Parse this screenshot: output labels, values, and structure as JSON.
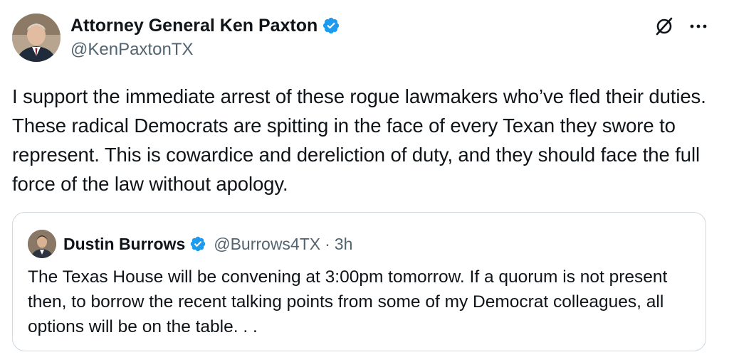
{
  "tweet": {
    "author": {
      "display_name": "Attorney General Ken Paxton",
      "handle": "@KenPaxtonTX",
      "avatar_icon": "avatar-ken-paxton",
      "verified_icon": "verified-badge-icon",
      "verified_color": "#1d9bf0"
    },
    "actions": {
      "grok_icon": "grok-icon",
      "more_icon": "more-icon"
    },
    "text": "I support the immediate arrest of these rogue lawmakers who’ve fled their duties. These radical Democrats are spitting in the face of every Texan they swore to represent. This is cowardice and dereliction of duty, and they should face the full force of the law without apology.",
    "quote": {
      "display_name": "Dustin Burrows",
      "handle": "@Burrows4TX",
      "separator": "·",
      "time": "3h",
      "avatar_icon": "avatar-dustin-burrows",
      "verified_icon": "verified-badge-icon",
      "text": "The Texas House will be convening at 3:00pm tomorrow. If a quorum is not present then, to borrow the recent talking points from some of my Democrat colleagues, all options will be on the table. . ."
    }
  },
  "colors": {
    "text_primary": "#0f1419",
    "text_secondary": "#536471",
    "border": "#cfd9de",
    "accent_blue": "#1d9bf0"
  }
}
